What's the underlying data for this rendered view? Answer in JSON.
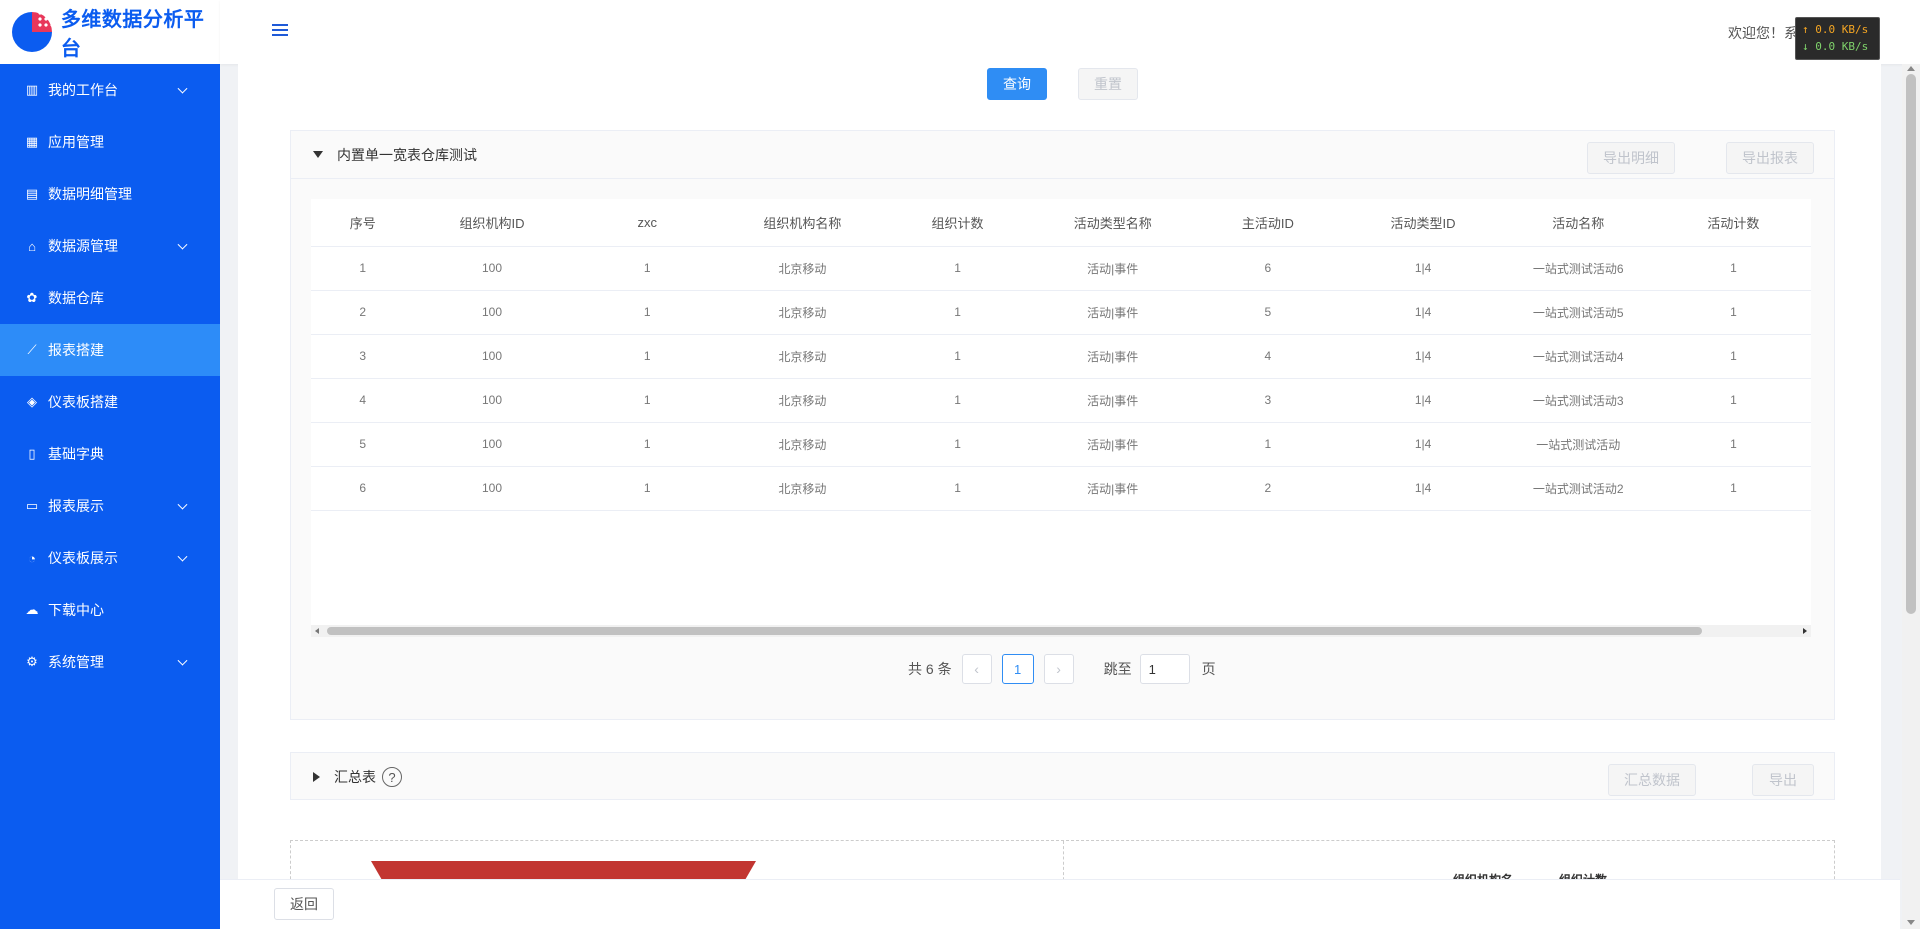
{
  "app": {
    "title": "多维数据分析平台"
  },
  "sidebar": {
    "items": [
      {
        "label": "我的工作台",
        "icon": "dashboard-icon",
        "glyph": "▥",
        "expandable": true,
        "active": false
      },
      {
        "label": "应用管理",
        "icon": "apps-icon",
        "glyph": "▦",
        "expandable": false,
        "active": false
      },
      {
        "label": "数据明细管理",
        "icon": "document-icon",
        "glyph": "▤",
        "expandable": false,
        "active": false
      },
      {
        "label": "数据源管理",
        "icon": "datasource-icon",
        "glyph": "⌂",
        "expandable": true,
        "active": false
      },
      {
        "label": "数据仓库",
        "icon": "warehouse-icon",
        "glyph": "✿",
        "expandable": false,
        "active": false
      },
      {
        "label": "报表搭建",
        "icon": "line-chart-icon",
        "glyph": "⟋",
        "expandable": false,
        "active": true
      },
      {
        "label": "仪表板搭建",
        "icon": "layers-icon",
        "glyph": "◈",
        "expandable": false,
        "active": false
      },
      {
        "label": "基础字典",
        "icon": "book-icon",
        "glyph": "▯",
        "expandable": false,
        "active": false
      },
      {
        "label": "报表展示",
        "icon": "monitor-chart-icon",
        "glyph": "▭",
        "expandable": true,
        "active": false
      },
      {
        "label": "仪表板展示",
        "icon": "pie-chart-icon",
        "glyph": "◔",
        "expandable": true,
        "active": false
      },
      {
        "label": "下载中心",
        "icon": "cloud-download-icon",
        "glyph": "☁",
        "expandable": false,
        "active": false
      },
      {
        "label": "系统管理",
        "icon": "gear-icon",
        "glyph": "⚙",
        "expandable": true,
        "active": false
      }
    ]
  },
  "header": {
    "welcome": "欢迎您！系",
    "net_up": "↑ 0.0 KB/s",
    "net_down": "↓ 0.0 KB/s"
  },
  "toolbar": {
    "query_label": "查询",
    "reset_label": "重置"
  },
  "panel_detail": {
    "title": "内置单一宽表仓库测试",
    "export_detail_label": "导出明细",
    "export_report_label": "导出报表",
    "columns": [
      "序号",
      "组织机构ID",
      "zxc",
      "组织机构名称",
      "组织计数",
      "活动类型名称",
      "主活动ID",
      "活动类型ID",
      "活动名称",
      "活动计数"
    ],
    "rows": [
      [
        "1",
        "100",
        "1",
        "北京移动",
        "1",
        "活动|事件",
        "6",
        "1|4",
        "一站式测试活动6",
        "1"
      ],
      [
        "2",
        "100",
        "1",
        "北京移动",
        "1",
        "活动|事件",
        "5",
        "1|4",
        "一站式测试活动5",
        "1"
      ],
      [
        "3",
        "100",
        "1",
        "北京移动",
        "1",
        "活动|事件",
        "4",
        "1|4",
        "一站式测试活动4",
        "1"
      ],
      [
        "4",
        "100",
        "1",
        "北京移动",
        "1",
        "活动|事件",
        "3",
        "1|4",
        "一站式测试活动3",
        "1"
      ],
      [
        "5",
        "100",
        "1",
        "北京移动",
        "1",
        "活动|事件",
        "1",
        "1|4",
        "一站式测试活动",
        "1"
      ],
      [
        "6",
        "100",
        "1",
        "北京移动",
        "1",
        "活动|事件",
        "2",
        "1|4",
        "一站式测试活动2",
        "1"
      ]
    ],
    "pagination": {
      "total": "共 6 条",
      "prev": "‹",
      "current": "1",
      "next": "›",
      "jump_label": "跳至",
      "jump_value": "1",
      "page_suffix": "页"
    }
  },
  "panel_summary": {
    "title": "汇总表",
    "help": "?",
    "summary_data_label": "汇总数据",
    "export_label": "导出"
  },
  "chart_preview": {
    "col_1": "组织机构名",
    "col_2": "组织计数"
  },
  "footer": {
    "back_label": "返回"
  },
  "colors": {
    "sidebar_bg": "#0b5cf0",
    "active_item": "#2d8cf8",
    "primary": "#2f8df4",
    "chart_red": "#c23531"
  }
}
